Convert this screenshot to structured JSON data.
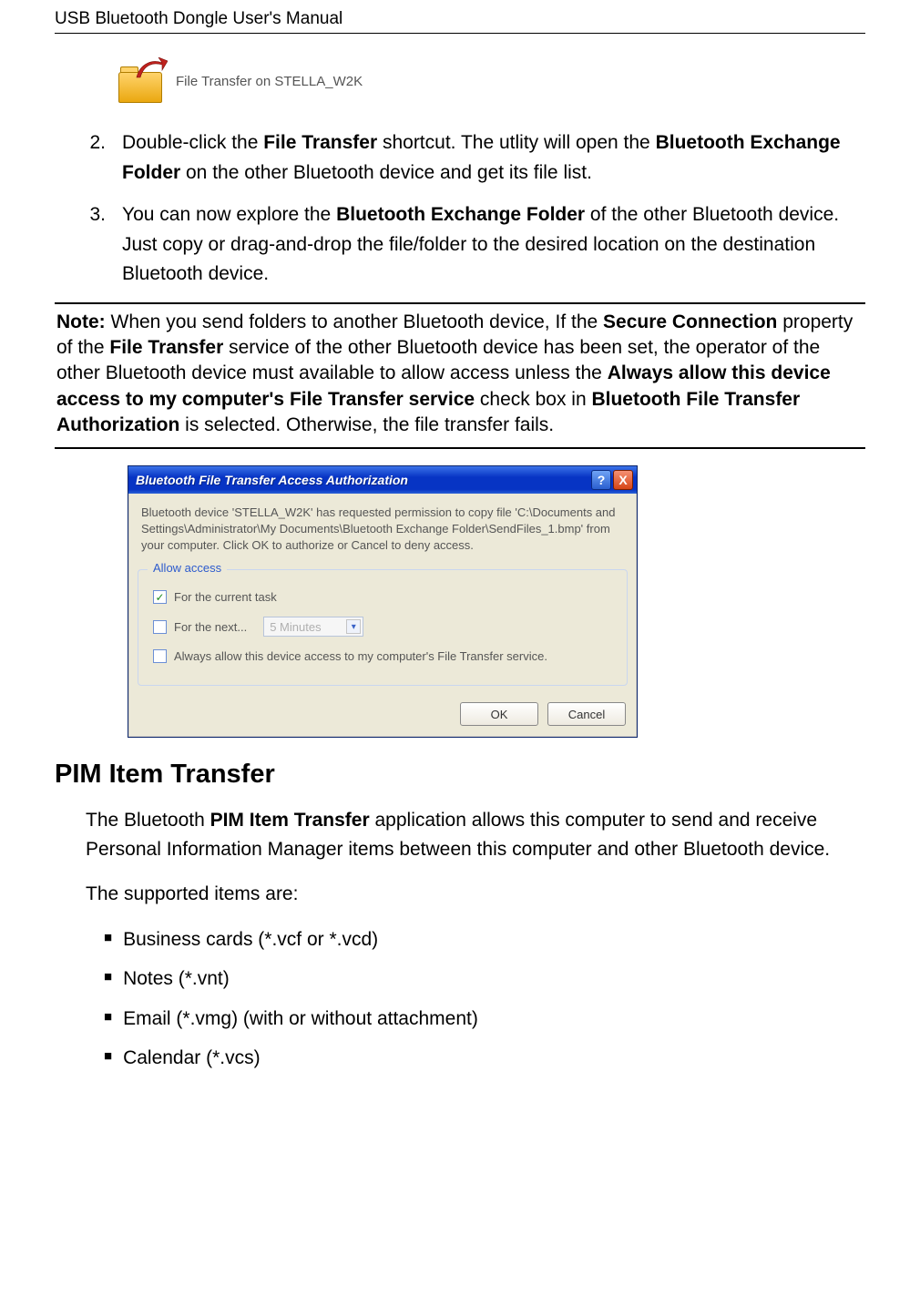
{
  "header": "USB Bluetooth Dongle User's Manual",
  "shortcut_label": "File Transfer on STELLA_W2K",
  "steps": [
    {
      "num": "2.",
      "text_pre": "Double-click the ",
      "bold1": "File Transfer",
      "mid1": " shortcut. The utlity will open the ",
      "bold2": "Bluetooth Exchange Folder",
      "tail": " on the other Bluetooth device and get its file list."
    },
    {
      "num": "3.",
      "text_pre": "You can now explore the ",
      "bold1": "Bluetooth Exchange Folder",
      "tail": " of the other Bluetooth device. Just copy or drag-and-drop the file/folder to the desired location on the destination Bluetooth device."
    }
  ],
  "note": {
    "label": "Note:",
    "p1": " When you send folders to another Bluetooth device, If the ",
    "b1": "Secure Connection",
    "p2": " property of the ",
    "b2": "File Transfer",
    "p3": " service of the other Bluetooth device has been set, the operator of the other Bluetooth device must available to allow access unless the ",
    "b3": "Always allow this device access to my computer's File Transfer service",
    "p4": " check box in ",
    "b4": "Bluetooth File Transfer Authorization",
    "p5": " is selected. Otherwise, the file transfer fails."
  },
  "dialog": {
    "title": "Bluetooth File Transfer Access Authorization",
    "help": "?",
    "close": "X",
    "body": "Bluetooth device 'STELLA_W2K' has requested permission to copy file 'C:\\Documents and Settings\\Administrator\\My Documents\\Bluetooth Exchange Folder\\SendFiles_1.bmp' from your computer.  Click OK to authorize or Cancel to deny access.",
    "group_legend": "Allow access",
    "chk1": "For the current task",
    "chk2": "For the next...",
    "combo_value": "5 Minutes",
    "chk3": "Always allow this device access to my computer's File Transfer service.",
    "ok": "OK",
    "cancel": "Cancel"
  },
  "section_title": "PIM Item Transfer",
  "pim_para_pre": "The Bluetooth ",
  "pim_para_bold": "PIM Item Transfer",
  "pim_para_tail": " application allows this computer to send and receive Personal Information Manager items between this computer and other Bluetooth device.",
  "supported_line": "The supported items are:",
  "items": [
    "Business cards (*.vcf or *.vcd)",
    "Notes (*.vnt)",
    "Email (*.vmg) (with or without attachment)",
    "Calendar (*.vcs)"
  ]
}
